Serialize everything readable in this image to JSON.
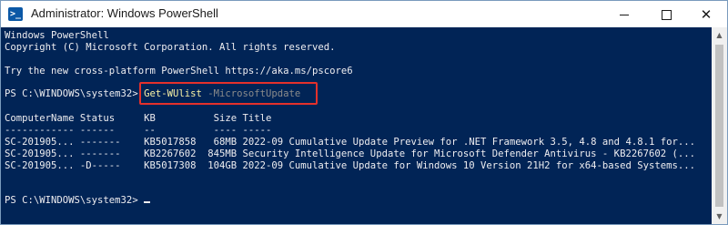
{
  "window": {
    "title": "Administrator: Windows PowerShell",
    "app_icon": "powershell-icon",
    "app_icon_glyph": ">_",
    "controls": {
      "minimize": "minimize-icon",
      "maximize": "maximize-icon",
      "close": "close-icon"
    },
    "close_glyph": "✕"
  },
  "console": {
    "banner": [
      "Windows PowerShell",
      "Copyright (C) Microsoft Corporation. All rights reserved.",
      "",
      "Try the new cross-platform PowerShell https://aka.ms/pscore6"
    ],
    "prompt": "PS C:\\WINDOWS\\system32> ",
    "command_name": "Get-WUlist",
    "command_param": " -MicrosoftUpdate",
    "table_header": "ComputerName Status     KB          Size Title",
    "table_separator": "------------ ------     --          ---- -----",
    "rows": [
      "SC-201905... -------    KB5017858   68MB 2022-09 Cumulative Update Preview for .NET Framework 3.5, 4.8 and 4.8.1 for...",
      "SC-201905... -------    KB2267602  845MB Security Intelligence Update for Microsoft Defender Antivirus - KB2267602 (...",
      "SC-201905... -D-----    KB5017308  104GB 2022-09 Cumulative Update for Windows 10 Version 21H2 for x64-based Systems..."
    ],
    "final_prompt": "PS C:\\WINDOWS\\system32> "
  },
  "colors": {
    "console_background": "#012456",
    "console_text": "#eeedf0",
    "command_name": "#f9f1a5",
    "command_param": "#8b8b8b",
    "highlight_border": "#e4312b"
  },
  "scrollbar": {
    "up": "scroll-up-icon",
    "down": "scroll-down-icon",
    "up_glyph": "▲",
    "down_glyph": "▼"
  }
}
